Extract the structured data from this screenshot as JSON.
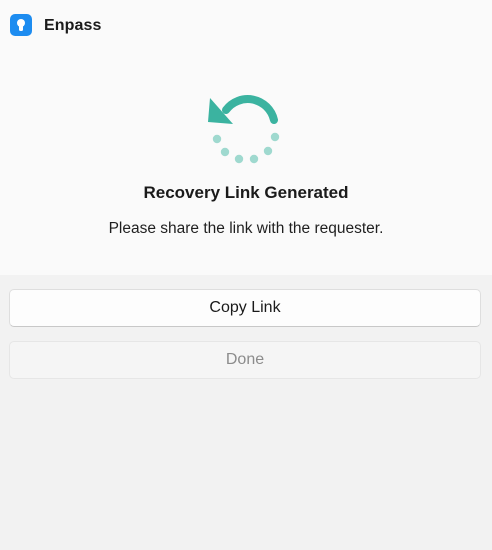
{
  "window": {
    "app_title": "Enpass",
    "app_icon": "enpass-keyhole-icon",
    "accent_color": "#1d8cf0"
  },
  "content": {
    "status_icon": "recovery-refresh-icon",
    "status_icon_color": "#3bb3a0",
    "headline": "Recovery Link Generated",
    "message": "Please share the link with the requester."
  },
  "actions": {
    "copy_label": "Copy Link",
    "done_label": "Done",
    "done_disabled": true
  }
}
